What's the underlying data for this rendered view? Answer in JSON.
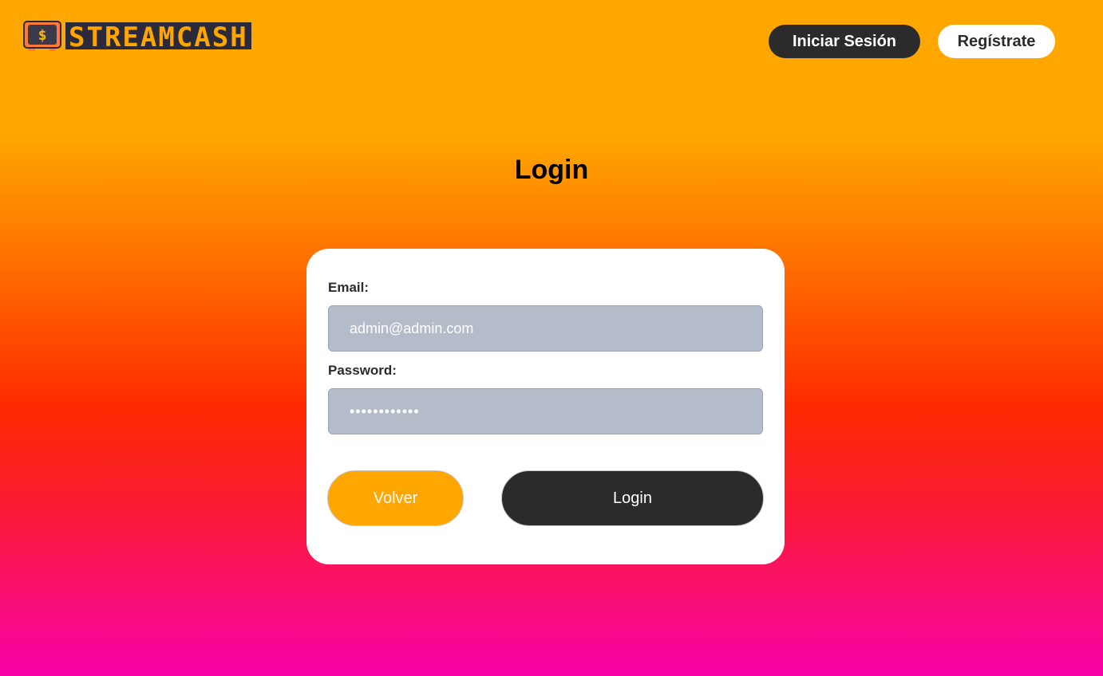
{
  "header": {
    "brand": "STREAMCASH",
    "logo_icon": "tv-dollar-icon",
    "nav": {
      "login_label": "Iniciar Sesión",
      "register_label": "Regístrate"
    }
  },
  "page": {
    "title": "Login"
  },
  "form": {
    "email_label": "Email:",
    "email_value": "admin@admin.com",
    "password_label": "Password:",
    "password_value": "••••••••••••",
    "back_label": "Volver",
    "submit_label": "Login"
  },
  "colors": {
    "accent": "#ffa600",
    "dark": "#2b2b2b",
    "input_bg": "#b4bcc9",
    "gradient_top": "#ffa600",
    "gradient_mid": "#fe2a00",
    "gradient_bottom": "#f800a8"
  }
}
